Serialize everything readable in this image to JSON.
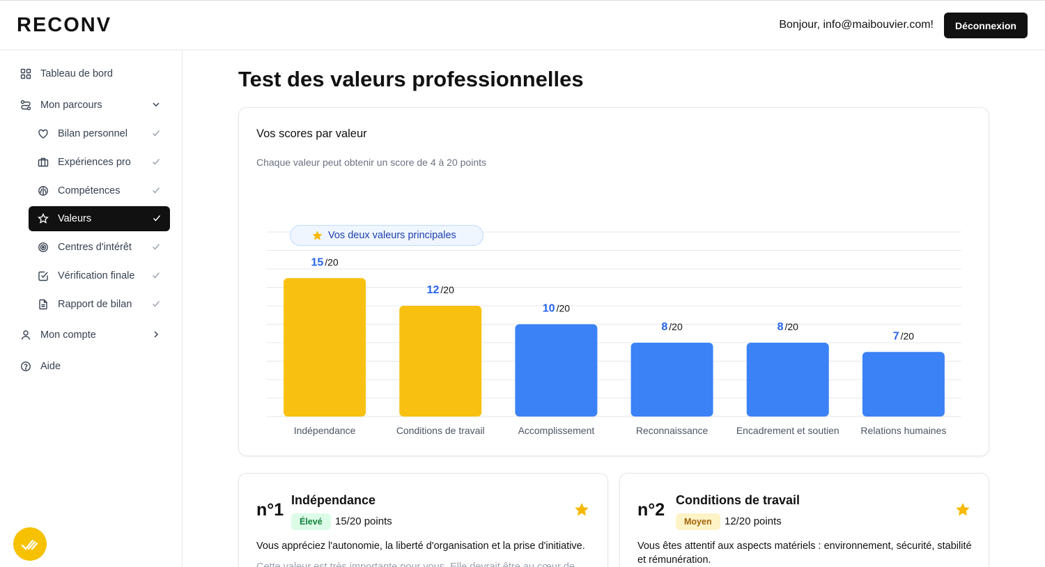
{
  "header": {
    "logo": "RECONV",
    "greeting": "Bonjour, info@maibouvier.com!",
    "logout_label": "Déconnexion"
  },
  "sidebar": {
    "items": [
      {
        "label": "Tableau de bord",
        "icon": "grid-icon"
      },
      {
        "label": "Mon parcours",
        "icon": "route-icon",
        "tail": "chevron-down-icon"
      },
      {
        "label": "Bilan personnel",
        "icon": "heart-icon",
        "tail": "check-icon"
      },
      {
        "label": "Expériences pro",
        "icon": "briefcase-icon",
        "tail": "check-icon"
      },
      {
        "label": "Compétences",
        "icon": "brain-icon",
        "tail": "check-icon"
      },
      {
        "label": "Valeurs",
        "icon": "star-icon",
        "tail": "check-icon",
        "active": true
      },
      {
        "label": "Centres d'intérêt",
        "icon": "target-icon",
        "tail": "check-icon"
      },
      {
        "label": "Vérification finale",
        "icon": "checkbox-icon",
        "tail": "check-icon"
      },
      {
        "label": "Rapport de bilan",
        "icon": "document-icon",
        "tail": "check-icon"
      },
      {
        "label": "Mon compte",
        "icon": "user-icon",
        "tail": "chevron-right-icon"
      },
      {
        "label": "Aide",
        "icon": "help-circle-icon"
      }
    ]
  },
  "page": {
    "title": "Test des valeurs professionnelles"
  },
  "chart_card": {
    "title": "Vos scores par valeur",
    "subtitle": "Chaque valeur peut obtenir un score de 4 à 20 points",
    "highlight_label": "Vos deux valeurs principales"
  },
  "chart_data": {
    "type": "bar",
    "categories": [
      "Indépendance",
      "Conditions de travail",
      "Accomplissement",
      "Reconnaissance",
      "Encadrement et soutien",
      "Relations humaines"
    ],
    "values": [
      15,
      12,
      10,
      8,
      8,
      7
    ],
    "max": 20,
    "value_suffix": "/20",
    "ylim": [
      0,
      20
    ],
    "grid": true,
    "highlight_count": 2,
    "colors": {
      "highlight": "#f8c112",
      "normal": "#3b82f6",
      "value_text": "#2563eb"
    }
  },
  "rank_cards": [
    {
      "rank": "n°1",
      "name": "Indépendance",
      "badge": "Élevé",
      "points": "15/20 points",
      "description": "Vous appréciez l'autonomie, la liberté d'organisation et la prise d'initiative.",
      "detail": "Cette valeur est très importante pour vous. Elle devrait être au cœur de"
    },
    {
      "rank": "n°2",
      "name": "Conditions de travail",
      "badge": "Moyen",
      "points": "12/20 points",
      "description": "Vous êtes attentif aux aspects matériels : environnement, sécurité, stabilité et rémunération."
    }
  ]
}
